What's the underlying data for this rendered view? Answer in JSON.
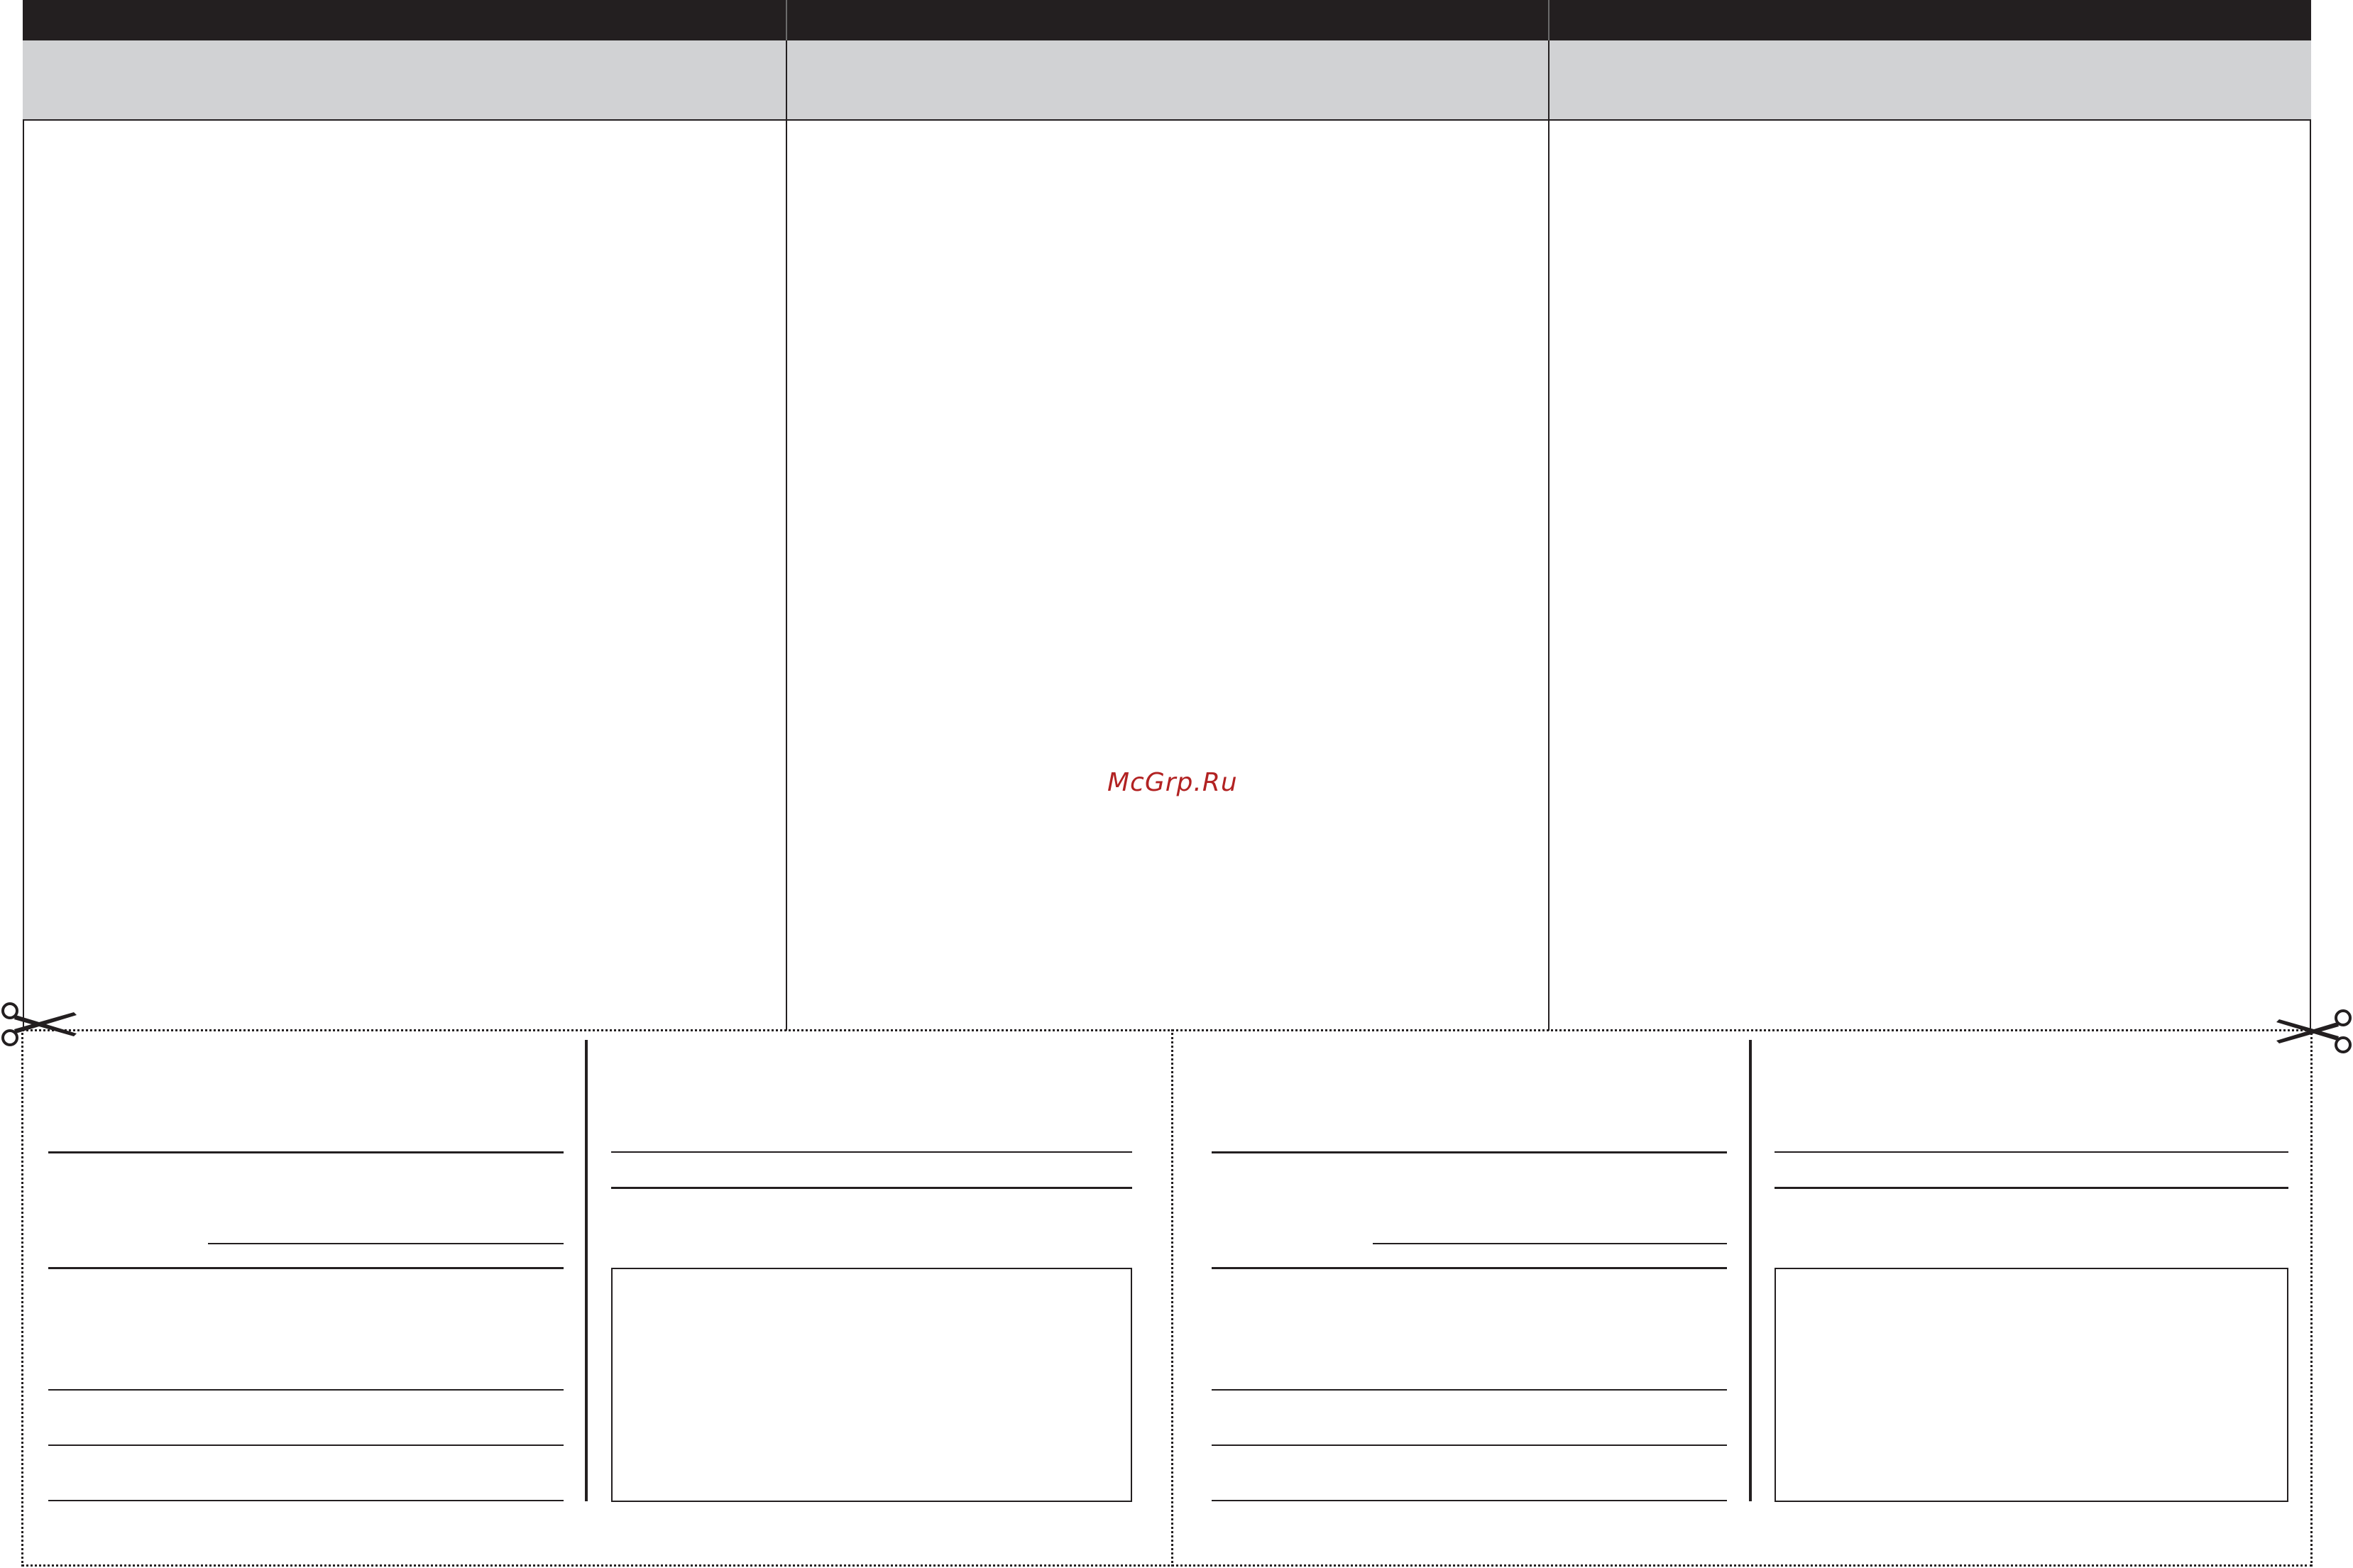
{
  "watermark": {
    "text": "McGrp.Ru"
  },
  "colors": {
    "header": "#231f20",
    "subheader": "#d1d2d4",
    "watermark": "#b22222"
  },
  "icons": {
    "left_cut": "scissors-icon",
    "right_cut": "scissors-icon"
  }
}
